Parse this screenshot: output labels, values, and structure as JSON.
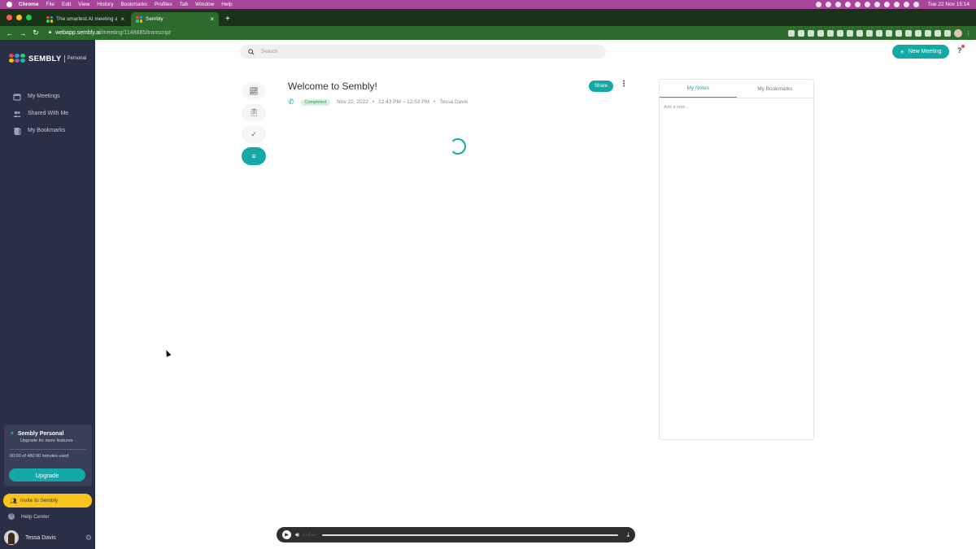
{
  "menubar": {
    "app": "Chrome",
    "items": [
      "File",
      "Edit",
      "View",
      "History",
      "Bookmarks",
      "Profiles",
      "Tab",
      "Window",
      "Help"
    ],
    "clock": "Tue 22 Nov  15:14"
  },
  "browser": {
    "tabs": [
      {
        "title": "The smartest AI meeting assis"
      },
      {
        "title": "Sembly"
      }
    ],
    "url_host": "webapp.sembly.ai",
    "url_path": "/meeting/1148885/transcript"
  },
  "sidebar": {
    "brand": "SEMBLY",
    "plan_label": "Personal",
    "nav": [
      {
        "label": "My Meetings",
        "icon": "calendar-icon"
      },
      {
        "label": "Shared With Me",
        "icon": "people-icon"
      },
      {
        "label": "My Bookmarks",
        "icon": "bookmark-icon"
      }
    ],
    "plan_card": {
      "title": "Sembly Personal",
      "subtitle": "Upgrade for more features",
      "usage": "00:00 of 480:00 minutes used",
      "upgrade": "Upgrade"
    },
    "invite": "Invite to Sembly",
    "help": "Help Center",
    "user": "Tessa Davis"
  },
  "main": {
    "search_placeholder": "Search",
    "new_meeting": "New Meeting",
    "help_mark": "?",
    "meeting": {
      "title": "Welcome to Sembly!",
      "status": "Completed",
      "date": "Nov 22, 2022",
      "time": "12:43 PM – 12:53 PM",
      "owner": "Tessa Davis",
      "share": "Share"
    },
    "notes": {
      "tabs": [
        "My Notes",
        "My Bookmarks"
      ],
      "placeholder": "Add a note..."
    },
    "player": {
      "time": "-:- / -:-"
    }
  },
  "colors": {
    "accent": "#13a9a6",
    "sidebar_bg": "#2b2f45",
    "invite": "#f8c41b"
  }
}
